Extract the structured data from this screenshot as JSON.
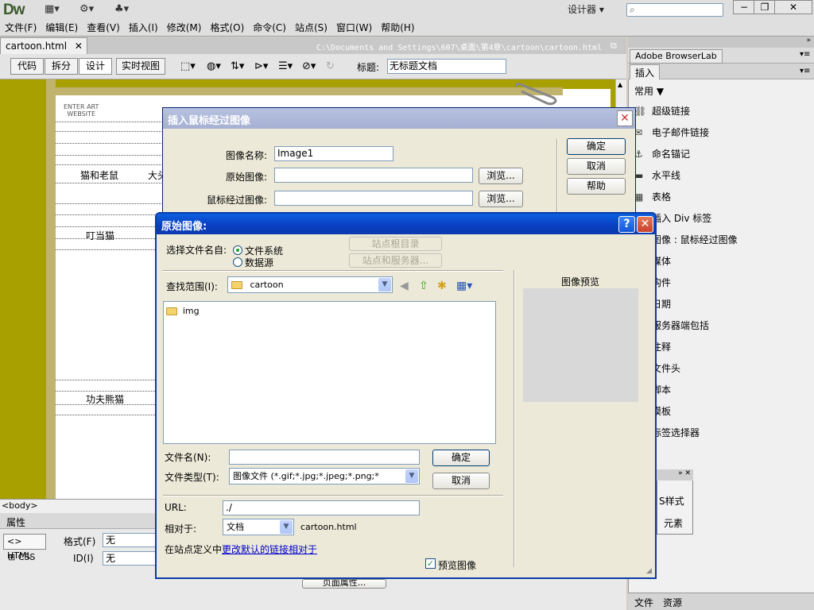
{
  "app": {
    "logo": "Dw",
    "workspace_mode": "设计器",
    "search_placeholder": "",
    "menus": [
      "文件(F)",
      "编辑(E)",
      "查看(V)",
      "插入(I)",
      "修改(M)",
      "格式(O)",
      "命令(C)",
      "站点(S)",
      "窗口(W)",
      "帮助(H)"
    ]
  },
  "document": {
    "tab_name": "cartoon.html",
    "path": "C:\\Documents and Settings\\607\\桌面\\第4章\\cartoon\\cartoon.html",
    "view_buttons": [
      "代码",
      "拆分",
      "设计",
      "实时视图"
    ],
    "title_label": "标题:",
    "title_value": "无标题文档",
    "canvas": {
      "logo_line1": "ENTER ART",
      "logo_line2": "WEBSITE",
      "cells": [
        "猫和老鼠",
        "大头",
        "叮当猫",
        "功夫熊猫"
      ]
    }
  },
  "status": {
    "tag": "<body>"
  },
  "properties": {
    "header": "属性",
    "html_btn": "HTML",
    "css_btn": "CSS",
    "format_label": "格式(F)",
    "format_value": "无",
    "id_label": "ID(I)",
    "id_value": "无",
    "page_props_btn": "页面属性..."
  },
  "right_panel": {
    "browserlab_tab": "Adobe BrowserLab",
    "insert_tab": "插入",
    "category": "常用",
    "items": [
      {
        "label": "超级链接",
        "icon": "hyperlink-icon"
      },
      {
        "label": "电子邮件链接",
        "icon": "email-icon"
      },
      {
        "label": "命名锚记",
        "icon": "anchor-icon"
      },
      {
        "label": "水平线",
        "icon": "hr-icon"
      },
      {
        "label": "表格",
        "icon": "table-icon"
      },
      {
        "label": "插入 Div 标签",
        "icon": "div-icon"
      },
      {
        "label": "图像 : 鼠标经过图像",
        "icon": "image-icon"
      },
      {
        "label": "媒体",
        "icon": "media-icon"
      },
      {
        "label": "构件",
        "icon": "widget-icon"
      },
      {
        "label": "日期",
        "icon": "date-icon"
      },
      {
        "label": "服务器端包括",
        "icon": "ssi-icon"
      },
      {
        "label": "注释",
        "icon": "comment-icon"
      },
      {
        "label": "文件头",
        "icon": "head-icon"
      },
      {
        "label": "脚本",
        "icon": "script-icon"
      },
      {
        "label": "模板",
        "icon": "template-icon"
      },
      {
        "label": "标签选择器",
        "icon": "tag-chooser-icon"
      }
    ],
    "mini_panel_item1": "S样式",
    "mini_panel_item2": "元素",
    "files_tab": "文件",
    "assets_tab": "资源"
  },
  "rollover_dialog": {
    "title": "插入鼠标经过图像",
    "image_name_label": "图像名称:",
    "image_name_value": "Image1",
    "original_label": "原始图像:",
    "original_value": "",
    "rollover_label": "鼠标经过图像:",
    "rollover_value": "",
    "browse": "浏览...",
    "ok": "确定",
    "cancel": "取消",
    "help": "帮助"
  },
  "file_dialog": {
    "title": "原始图像:",
    "select_from_label": "选择文件名自:",
    "opt_filesystem": "文件系统",
    "opt_datasource": "数据源",
    "site_root_btn": "站点根目录",
    "sites_servers_btn": "站点和服务器...",
    "look_in_label": "查找范围(I):",
    "look_in_value": "cartoon",
    "files": [
      {
        "name": "img",
        "icon": "folder-icon"
      }
    ],
    "preview_label": "图像预览",
    "filename_label": "文件名(N):",
    "filename_value": "",
    "filetype_label": "文件类型(T):",
    "filetype_value": "图像文件 (*.gif;*.jpg;*.jpeg;*.png;*",
    "ok": "确定",
    "cancel": "取消",
    "url_label": "URL:",
    "url_value": "./",
    "relative_label": "相对于:",
    "relative_value": "文档",
    "relative_file": "cartoon.html",
    "site_def_text": "在站点定义中",
    "site_def_link": "更改默认的链接相对于",
    "preview_checkbox": "预览图像",
    "preview_checked": true
  }
}
